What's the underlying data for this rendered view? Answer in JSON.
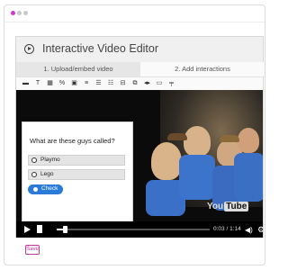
{
  "window": {
    "dots": [
      "#d23ad7",
      "#c8c8c8",
      "#c8c8c8"
    ]
  },
  "editor": {
    "title": "Interactive Video Editor",
    "tabs": [
      {
        "label": "1. Upload/embed video"
      },
      {
        "label": "2. Add interactions"
      }
    ],
    "toolbar": [
      {
        "icon": "bookmark-tool-icon",
        "glyph": "▬"
      },
      {
        "icon": "text-tool-icon",
        "glyph": "T"
      },
      {
        "icon": "table-tool-icon",
        "glyph": "▦"
      },
      {
        "icon": "link-tool-icon",
        "glyph": "%"
      },
      {
        "icon": "image-tool-icon",
        "glyph": "▣"
      },
      {
        "icon": "statements-tool-icon",
        "glyph": "≡"
      },
      {
        "icon": "single-choice-tool-icon",
        "glyph": "☰"
      },
      {
        "icon": "multiple-choice-tool-icon",
        "glyph": "☷"
      },
      {
        "icon": "fill-blanks-tool-icon",
        "glyph": "⊟"
      },
      {
        "icon": "summary-tool-icon",
        "glyph": "⧉"
      },
      {
        "icon": "drag-text-tool-icon",
        "glyph": "◂▸"
      },
      {
        "icon": "mark-words-tool-icon",
        "glyph": "▭"
      },
      {
        "icon": "navigation-tool-icon",
        "glyph": "╤"
      }
    ]
  },
  "video": {
    "question": "What are these guys called?",
    "options": [
      "Playmo",
      "Lego"
    ],
    "check_label": "Check",
    "logo_text": "You",
    "logo_box": "Tube",
    "time": "0:03 / 1:14",
    "progress": 0.04
  },
  "footer": {
    "save_label": "Save"
  },
  "colors": {
    "accent": "#c0379e",
    "check_button": "#2a7ad8"
  }
}
